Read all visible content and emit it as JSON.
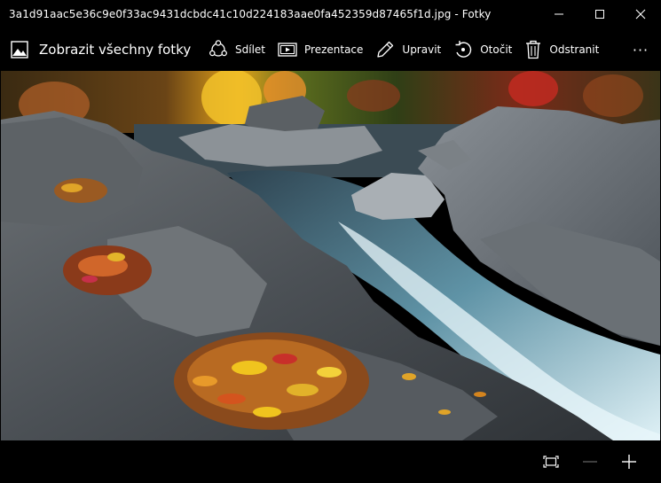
{
  "window": {
    "title": "3a1d91aac5e36c9e0f33ac9431dcbdc41c10d224183aae0fa452359d87465f1d.jpg - Fotky"
  },
  "toolbar": {
    "back_label": "Zobrazit všechny fotky",
    "share_label": "Sdílet",
    "slideshow_label": "Prezentace",
    "edit_label": "Upravit",
    "rotate_label": "Otočit",
    "delete_label": "Odstranit",
    "more_label": "···"
  },
  "icons": {
    "minimize": "minimize-icon",
    "maximize": "maximize-icon",
    "close": "close-icon",
    "photos": "photos-icon",
    "share": "share-icon",
    "slideshow": "slideshow-icon",
    "edit": "pencil-icon",
    "rotate": "rotate-icon",
    "delete": "trash-icon",
    "fit": "fit-screen-icon",
    "zoom_out": "zoom-out-icon",
    "zoom_in": "zoom-in-icon"
  },
  "colors": {
    "chrome_background": "#000000",
    "foreground": "#ffffff",
    "disabled": "#5a5a5a"
  }
}
